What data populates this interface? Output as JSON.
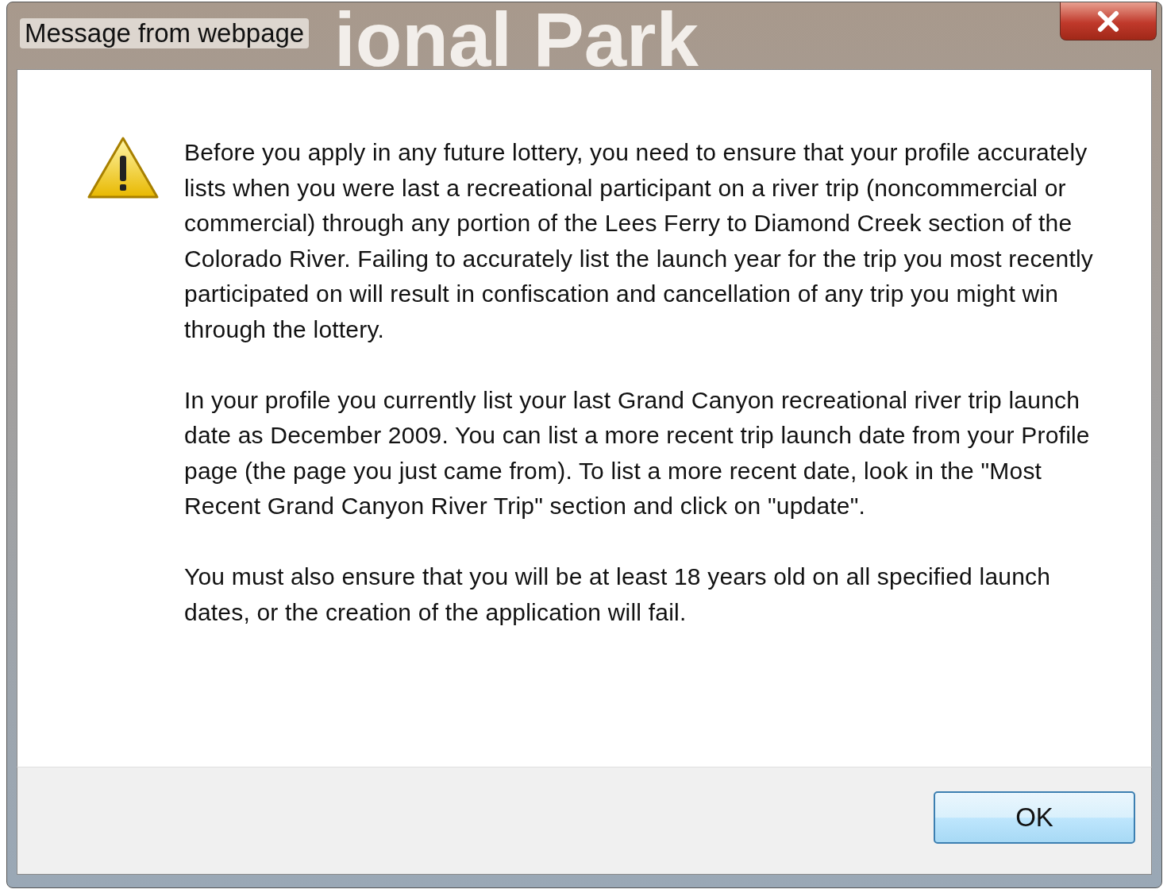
{
  "window": {
    "title": "Message from webpage",
    "background_text": "ional Park"
  },
  "message": {
    "paragraphs": [
      "Before you apply in any future lottery, you need to ensure that your profile accurately lists when you were last a recreational participant on a river trip (noncommercial or commercial) through any portion of the Lees Ferry to Diamond Creek section of the Colorado River. Failing to accurately list the launch year for the trip you most recently participated on will result in confiscation and cancellation of any trip you might win through the lottery.",
      "In your profile you currently list your last Grand Canyon recreational river trip launch date as December 2009. You can list a more recent trip launch date from your Profile page (the page you just came from). To list a more recent date, look in the \"Most Recent Grand Canyon River Trip\" section and click on \"update\".",
      "You must also ensure that you will be at least 18 years old on all specified launch dates, or the creation of the application will fail."
    ]
  },
  "buttons": [
    "OK"
  ]
}
